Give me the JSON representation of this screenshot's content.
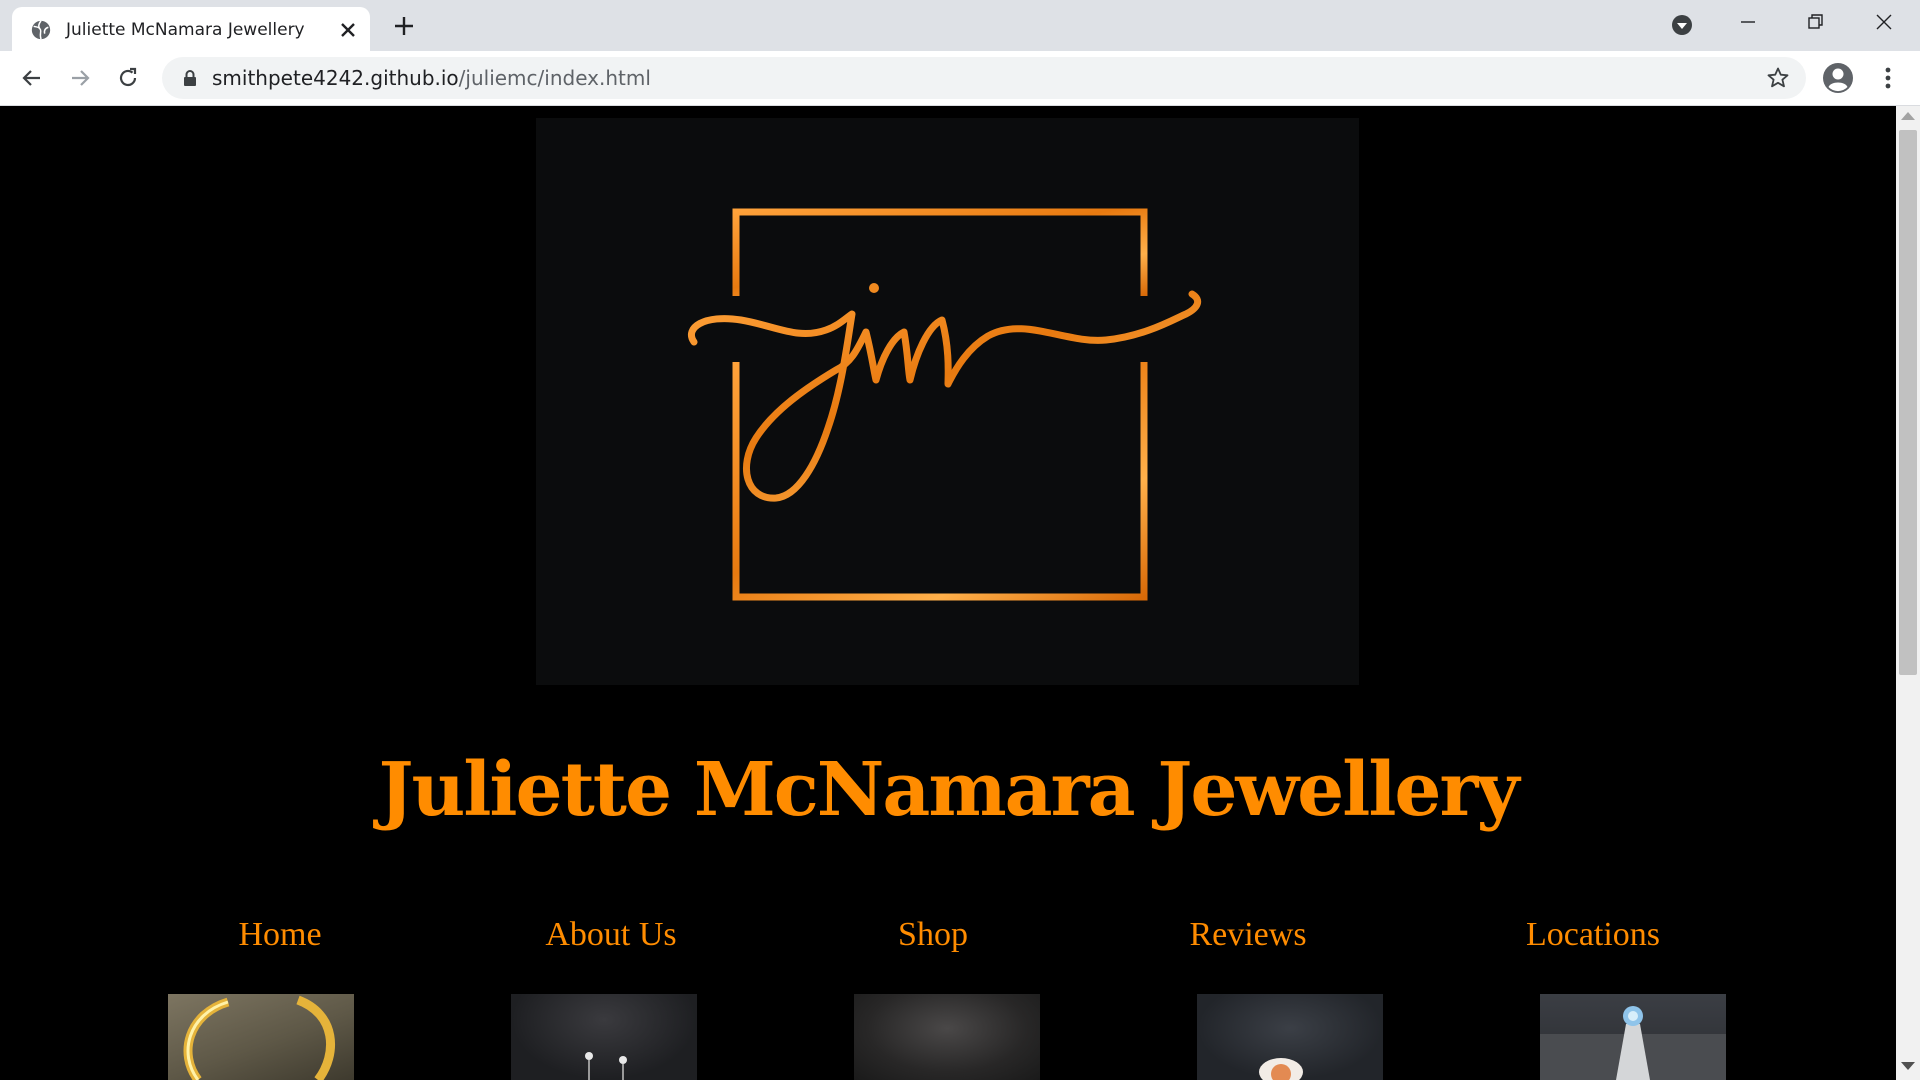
{
  "browser": {
    "tab": {
      "title": "Juliette McNamara Jewellery"
    },
    "address": {
      "host": "smithpete4242.github.io",
      "path": "/juliemc/index.html"
    }
  },
  "page": {
    "logo": {
      "monogram": "jm"
    },
    "title": "Juliette McNamara Jewellery",
    "nav": [
      {
        "label": "Home"
      },
      {
        "label": "About Us"
      },
      {
        "label": "Shop"
      },
      {
        "label": "Reviews"
      },
      {
        "label": "Locations"
      }
    ]
  },
  "colors": {
    "accent": "#ff8c00",
    "page_background": "#000000",
    "logo_background": "#0b0c0d"
  },
  "icons": [
    "globe-icon",
    "close-icon",
    "plus-icon",
    "tab-search-icon",
    "minimize-icon",
    "restore-icon",
    "back-arrow-icon",
    "forward-arrow-icon",
    "reload-icon",
    "lock-icon",
    "star-icon",
    "profile-icon",
    "kebab-menu-icon"
  ]
}
